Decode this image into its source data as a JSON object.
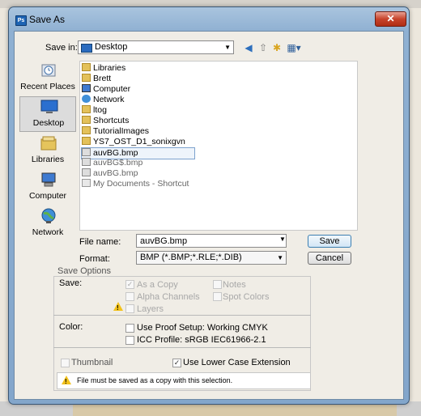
{
  "window": {
    "title": "Save As",
    "close_symbol": "✕"
  },
  "save_in": {
    "label": "Save in:",
    "value": "Desktop"
  },
  "places": [
    {
      "label": "Recent Places",
      "icon": "recent-places-icon"
    },
    {
      "label": "Desktop",
      "icon": "desktop-icon",
      "selected": true
    },
    {
      "label": "Libraries",
      "icon": "libraries-icon"
    },
    {
      "label": "Computer",
      "icon": "computer-icon"
    },
    {
      "label": "Network",
      "icon": "network-icon"
    }
  ],
  "files": [
    {
      "name": "Libraries",
      "type": "libraries"
    },
    {
      "name": "Brett",
      "type": "user"
    },
    {
      "name": "Computer",
      "type": "computer"
    },
    {
      "name": "Network",
      "type": "network"
    },
    {
      "name": "ltog",
      "type": "folder"
    },
    {
      "name": "Shortcuts",
      "type": "folder"
    },
    {
      "name": "TutorialImages",
      "type": "folder"
    },
    {
      "name": "YS7_OST_D1_sonixgvn",
      "type": "folder"
    },
    {
      "name": "auvBG.bmp",
      "type": "bmp",
      "selected": true
    },
    {
      "name": "auvBG$.bmp",
      "type": "bmp"
    },
    {
      "name": "auvBG.bmp",
      "type": "bmp"
    },
    {
      "name": "My Documents - Shortcut",
      "type": "shortcut"
    }
  ],
  "file_name": {
    "label": "File name:",
    "value": "auvBG.bmp"
  },
  "format": {
    "label": "Format:",
    "value": "BMP (*.BMP;*.RLE;*.DIB)"
  },
  "buttons": {
    "save": "Save",
    "cancel": "Cancel"
  },
  "save_options": {
    "title": "Save Options",
    "save_label": "Save:",
    "as_a_copy": {
      "label": "As a Copy",
      "checked": true,
      "disabled": true
    },
    "notes": {
      "label": "Notes",
      "checked": false,
      "disabled": true
    },
    "alpha_channels": {
      "label": "Alpha Channels",
      "checked": false,
      "disabled": true
    },
    "spot_colors": {
      "label": "Spot Colors",
      "checked": false,
      "disabled": true
    },
    "layers": {
      "label": "Layers",
      "checked": false,
      "disabled": true
    },
    "color_label": "Color:",
    "use_proof_setup": {
      "label": "Use Proof Setup:  Working CMYK",
      "checked": false
    },
    "icc_profile": {
      "label": "ICC Profile:  sRGB IEC61966-2.1",
      "checked": false
    },
    "thumbnail": {
      "label": "Thumbnail",
      "checked": false,
      "disabled": true
    },
    "lower_case_ext": {
      "label": "Use Lower Case Extension",
      "checked": true
    },
    "warning": "File must be saved as a copy with this selection."
  },
  "colors": {
    "title_bar": "#8fb0d2",
    "close_button": "#c7432c",
    "selection": "#7da2ce"
  }
}
